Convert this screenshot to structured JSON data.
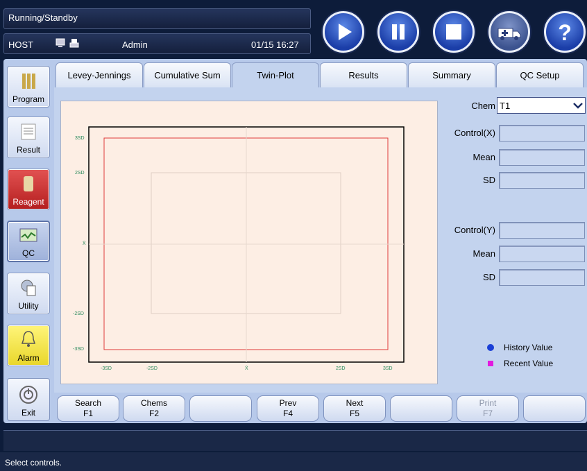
{
  "header": {
    "status_text": "Running/Standby",
    "host_label": "HOST",
    "user": "Admin",
    "datetime": "01/15 16:27"
  },
  "top_buttons": [
    {
      "name": "play-button",
      "icon": "play-icon"
    },
    {
      "name": "pause-button",
      "icon": "pause-icon"
    },
    {
      "name": "stop-button",
      "icon": "stop-icon"
    },
    {
      "name": "ambulance-button",
      "icon": "ambulance-icon"
    },
    {
      "name": "help-button",
      "icon": "help-icon"
    }
  ],
  "nav": {
    "program": "Program",
    "result": "Result",
    "reagent": "Reagent",
    "qc": "QC",
    "utility": "Utility",
    "alarm": "Alarm",
    "exit": "Exit"
  },
  "tabs": [
    "Levey-Jennings",
    "Cumulative Sum",
    "Twin-Plot",
    "Results",
    "Summary",
    "QC Setup"
  ],
  "active_tab": "Twin-Plot",
  "right_panel": {
    "chem_label": "Chem",
    "chem_value": "T1",
    "control_x_label": "Control(X)",
    "mean_x_label": "Mean",
    "sd_x_label": "SD",
    "control_y_label": "Control(Y)",
    "mean_y_label": "Mean",
    "sd_y_label": "SD",
    "control_x_value": "",
    "mean_x_value": "",
    "sd_x_value": "",
    "control_y_value": "",
    "mean_y_value": "",
    "sd_y_value": ""
  },
  "legend": {
    "history_label": "History Value",
    "recent_label": "Recent Value",
    "history_color": "#1a3fd6",
    "recent_color": "#e21adf"
  },
  "plot": {
    "y_labels": [
      "3SD",
      "2SD",
      "X̄",
      "-2SD",
      "-3SD"
    ],
    "x_labels": [
      "-3SD",
      "-2SD",
      "X̄",
      "2SD",
      "3SD"
    ],
    "label_color": "#2a8a5c"
  },
  "fkeys": [
    {
      "label": "Search",
      "key": "F1",
      "enabled": true
    },
    {
      "label": "Chems",
      "key": "F2",
      "enabled": true
    },
    {
      "label": "",
      "key": "",
      "enabled": true
    },
    {
      "label": "Prev",
      "key": "F4",
      "enabled": true
    },
    {
      "label": "Next",
      "key": "F5",
      "enabled": true
    },
    {
      "label": "",
      "key": "",
      "enabled": true
    },
    {
      "label": "Print",
      "key": "F7",
      "enabled": false
    },
    {
      "label": "",
      "key": "",
      "enabled": true
    }
  ],
  "status_message": "Select controls."
}
